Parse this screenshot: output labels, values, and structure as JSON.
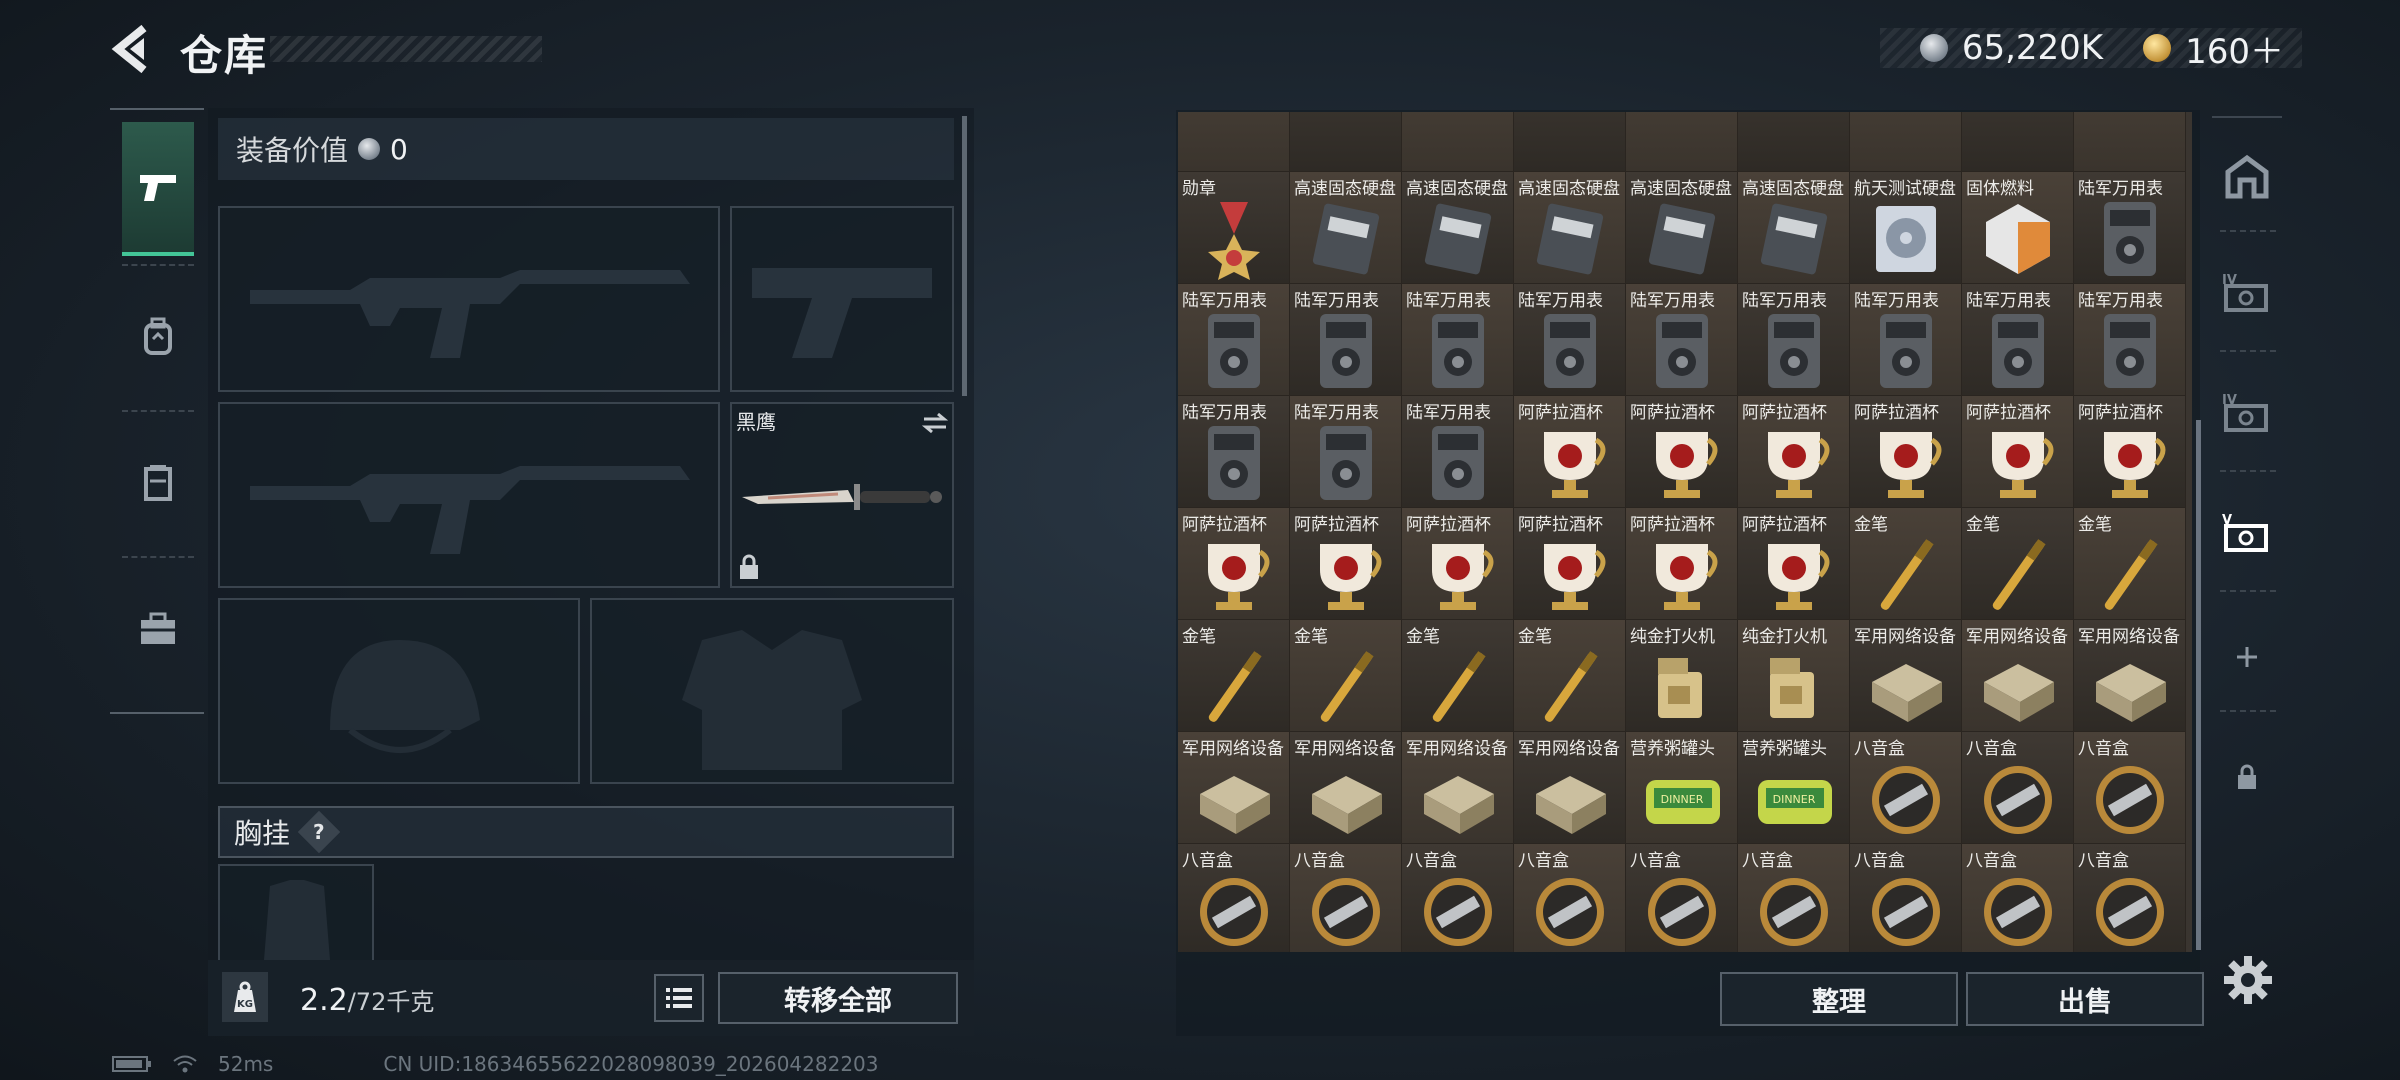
{
  "header": {
    "title": "仓库",
    "silver_amount": "65,220K",
    "gold_amount": "160＋"
  },
  "loadout": {
    "equip_value_label": "装备价值",
    "equip_value": "0",
    "melee_name": "黑鹰",
    "chest_label": "胸挂",
    "chest_help": "?",
    "weight_value": "2.2",
    "weight_capacity": "/72千克",
    "transfer_all_label": "转移全部"
  },
  "inventory": {
    "items": [
      "",
      "",
      "",
      "",
      "",
      "",
      "",
      "",
      "",
      "勋章",
      "高速固态硬盘",
      "高速固态硬盘",
      "高速固态硬盘",
      "高速固态硬盘",
      "高速固态硬盘",
      "航天测试硬盘",
      "固体燃料",
      "陆军万用表",
      "陆军万用表",
      "陆军万用表",
      "陆军万用表",
      "陆军万用表",
      "陆军万用表",
      "陆军万用表",
      "陆军万用表",
      "陆军万用表",
      "陆军万用表",
      "陆军万用表",
      "陆军万用表",
      "陆军万用表",
      "阿萨拉酒杯",
      "阿萨拉酒杯",
      "阿萨拉酒杯",
      "阿萨拉酒杯",
      "阿萨拉酒杯",
      "阿萨拉酒杯",
      "阿萨拉酒杯",
      "阿萨拉酒杯",
      "阿萨拉酒杯",
      "阿萨拉酒杯",
      "阿萨拉酒杯",
      "阿萨拉酒杯",
      "金笔",
      "金笔",
      "金笔",
      "金笔",
      "金笔",
      "金笔",
      "金笔",
      "纯金打火机",
      "纯金打火机",
      "军用网络设备",
      "军用网络设备",
      "军用网络设备",
      "军用网络设备",
      "军用网络设备",
      "军用网络设备",
      "军用网络设备",
      "营养粥罐头",
      "营养粥罐头",
      "八音盒",
      "八音盒",
      "八音盒",
      "八音盒",
      "八音盒",
      "八音盒",
      "八音盒",
      "八音盒",
      "八音盒",
      "八音盒",
      "八音盒",
      "八音盒"
    ],
    "sort_label": "整理",
    "sell_label": "出售"
  },
  "status_bar": {
    "ping": "52ms",
    "uid": "CN UID:1863465562202809803​9_202604282203"
  },
  "icons": {
    "back": "chevron-left-icon",
    "silver": "silver-coin-icon",
    "gold": "gold-coin-icon",
    "settings": "gear-icon"
  },
  "colors": {
    "accent_green": "#43c597",
    "item_bg": "#4a4138"
  }
}
